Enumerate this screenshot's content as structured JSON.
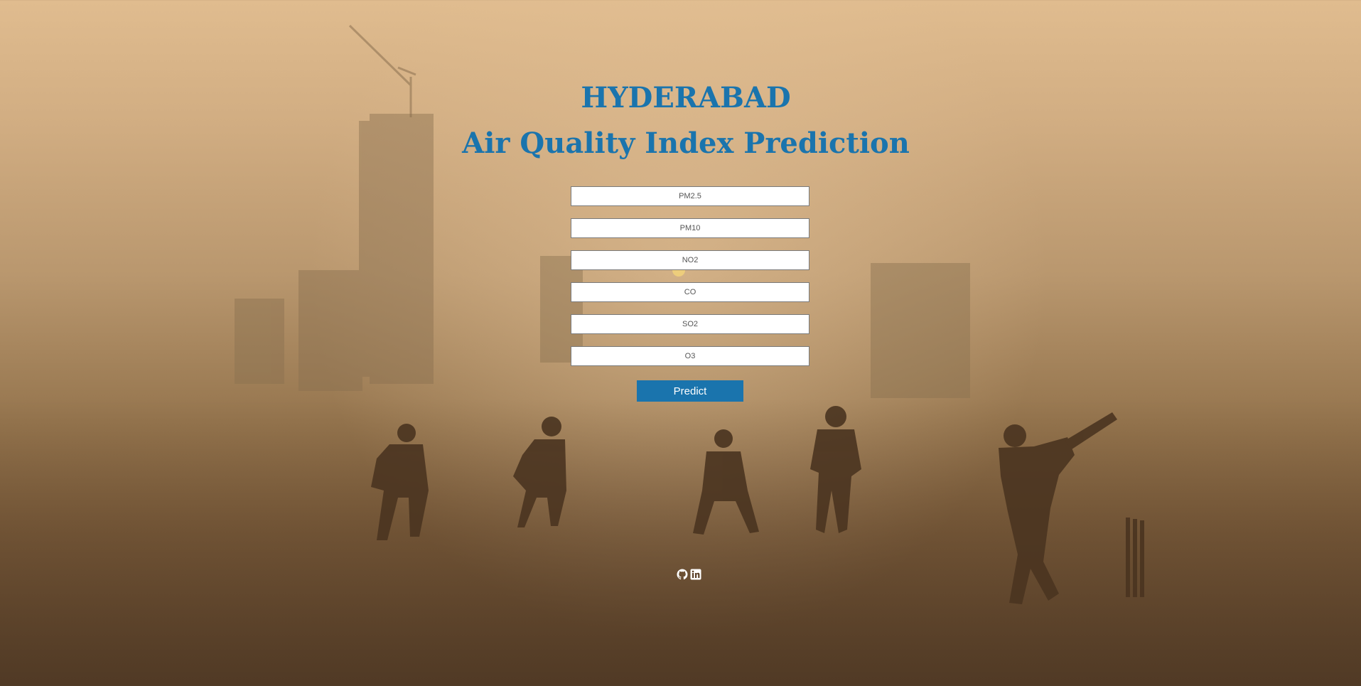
{
  "header": {
    "city": "HYDERABAD",
    "subtitle": "Air Quality Index Prediction"
  },
  "form": {
    "fields": [
      {
        "placeholder": "PM2.5"
      },
      {
        "placeholder": "PM10"
      },
      {
        "placeholder": "NO2"
      },
      {
        "placeholder": "CO"
      },
      {
        "placeholder": "SO2"
      },
      {
        "placeholder": "O3"
      }
    ],
    "submit_label": "Predict"
  },
  "footer": {
    "icons": [
      "github-icon",
      "linkedin-icon"
    ]
  },
  "theme": {
    "accent": "#1a74ad",
    "background_haze": "#c9a77c"
  }
}
